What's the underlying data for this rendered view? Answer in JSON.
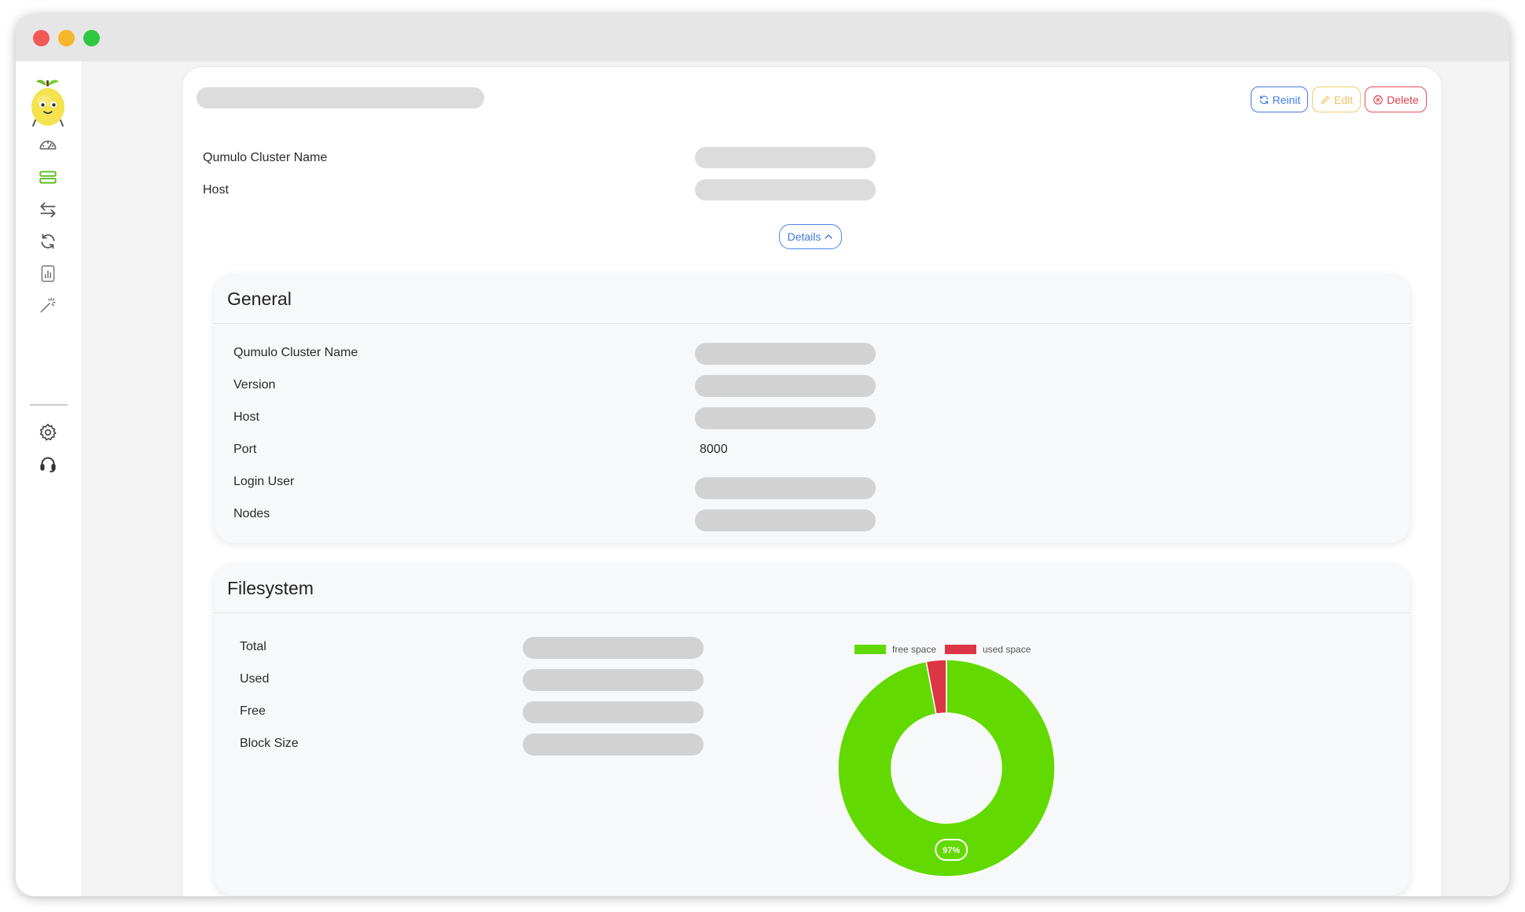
{
  "window": {
    "controls": [
      "close",
      "minimize",
      "maximize"
    ]
  },
  "sidebar": {
    "logo": "lemon-mascot-logo",
    "items": [
      {
        "name": "dashboard",
        "icon": "gauge-icon"
      },
      {
        "name": "storage",
        "icon": "storage-stack-icon",
        "active": true
      },
      {
        "name": "migrations",
        "icon": "arrows-left-right-icon"
      },
      {
        "name": "sync",
        "icon": "refresh-icon"
      },
      {
        "name": "reports",
        "icon": "bar-chart-icon"
      },
      {
        "name": "wizard",
        "icon": "magic-wand-icon"
      }
    ],
    "bottom_items": [
      {
        "name": "settings",
        "icon": "gear-icon"
      },
      {
        "name": "support",
        "icon": "headset-icon"
      }
    ]
  },
  "header": {
    "actions": {
      "reinit": "Reinit",
      "edit": "Edit",
      "delete": "Delete"
    }
  },
  "summary": {
    "rows": [
      {
        "label": "Qumulo Cluster Name"
      },
      {
        "label": "Host"
      }
    ],
    "details_label": "Details"
  },
  "general": {
    "title": "General",
    "rows": [
      {
        "label": "Qumulo Cluster Name",
        "value": null
      },
      {
        "label": "Version",
        "value": null
      },
      {
        "label": "Host",
        "value": null
      },
      {
        "label": "Port",
        "value": "8000"
      },
      {
        "label": "Login User",
        "value": null
      },
      {
        "label": "Nodes",
        "value": null
      }
    ]
  },
  "filesystem": {
    "title": "Filesystem",
    "rows": [
      {
        "label": "Total"
      },
      {
        "label": "Used"
      },
      {
        "label": "Free"
      },
      {
        "label": "Block Size"
      }
    ]
  },
  "colors": {
    "free": "#62d900",
    "used": "#dc3545",
    "accent": "#3d7de0",
    "warning": "#f0c35e",
    "danger": "#e04048"
  },
  "chart_data": {
    "type": "pie",
    "categories": [
      "free space",
      "used space"
    ],
    "values": [
      97,
      3
    ],
    "data_label": "97%",
    "legend_position": "top"
  }
}
